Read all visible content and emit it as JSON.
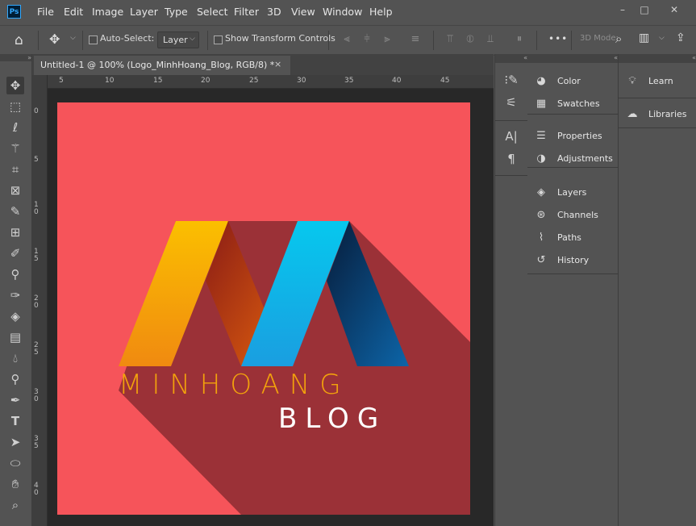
{
  "app": {
    "logo": "Ps"
  },
  "menu": [
    "File",
    "Edit",
    "Image",
    "Layer",
    "Type",
    "Select",
    "Filter",
    "3D",
    "View",
    "Window",
    "Help"
  ],
  "window_controls": {
    "minimize": "–",
    "maximize": "□",
    "close": "✕"
  },
  "options": {
    "auto_select_label": "Auto-Select:",
    "layer_value": "Layer",
    "show_transform_label": "Show Transform Controls",
    "more_label": "•••",
    "mode_3d_label": "3D Mode:"
  },
  "document": {
    "tab_title": "Untitled-1 @ 100% (Logo_MinhHoang_Blog, RGB/8) *",
    "close": "×"
  },
  "ruler": {
    "h_ticks": [
      "5",
      "10",
      "15",
      "20",
      "25",
      "30",
      "35",
      "40",
      "45"
    ],
    "v_ticks": [
      "0",
      "5",
      "1\n0",
      "1\n5",
      "2\n0",
      "2\n5",
      "3\n0",
      "3\n5",
      "4\n0"
    ]
  },
  "artwork": {
    "line1": "MINHOANG",
    "line2": "BLOG",
    "colors": {
      "background": "#f6545a",
      "shadow": "#9b3137",
      "orange": "#f2a20c",
      "blue": "#1ab6e8",
      "navy": "#0b4f86"
    }
  },
  "panels": {
    "col1": [
      {
        "icon": "color-icon",
        "label": "Color"
      },
      {
        "icon": "swatches-icon",
        "label": "Swatches"
      },
      {
        "icon": "properties-icon",
        "label": "Properties"
      },
      {
        "icon": "adjustments-icon",
        "label": "Adjustments"
      },
      {
        "icon": "layers-icon",
        "label": "Layers"
      },
      {
        "icon": "channels-icon",
        "label": "Channels"
      },
      {
        "icon": "paths-icon",
        "label": "Paths"
      },
      {
        "icon": "history-icon",
        "label": "History"
      }
    ],
    "col2": [
      {
        "icon": "learn-icon",
        "label": "Learn"
      },
      {
        "icon": "libraries-icon",
        "label": "Libraries"
      }
    ]
  },
  "collapse_glyph": "«"
}
